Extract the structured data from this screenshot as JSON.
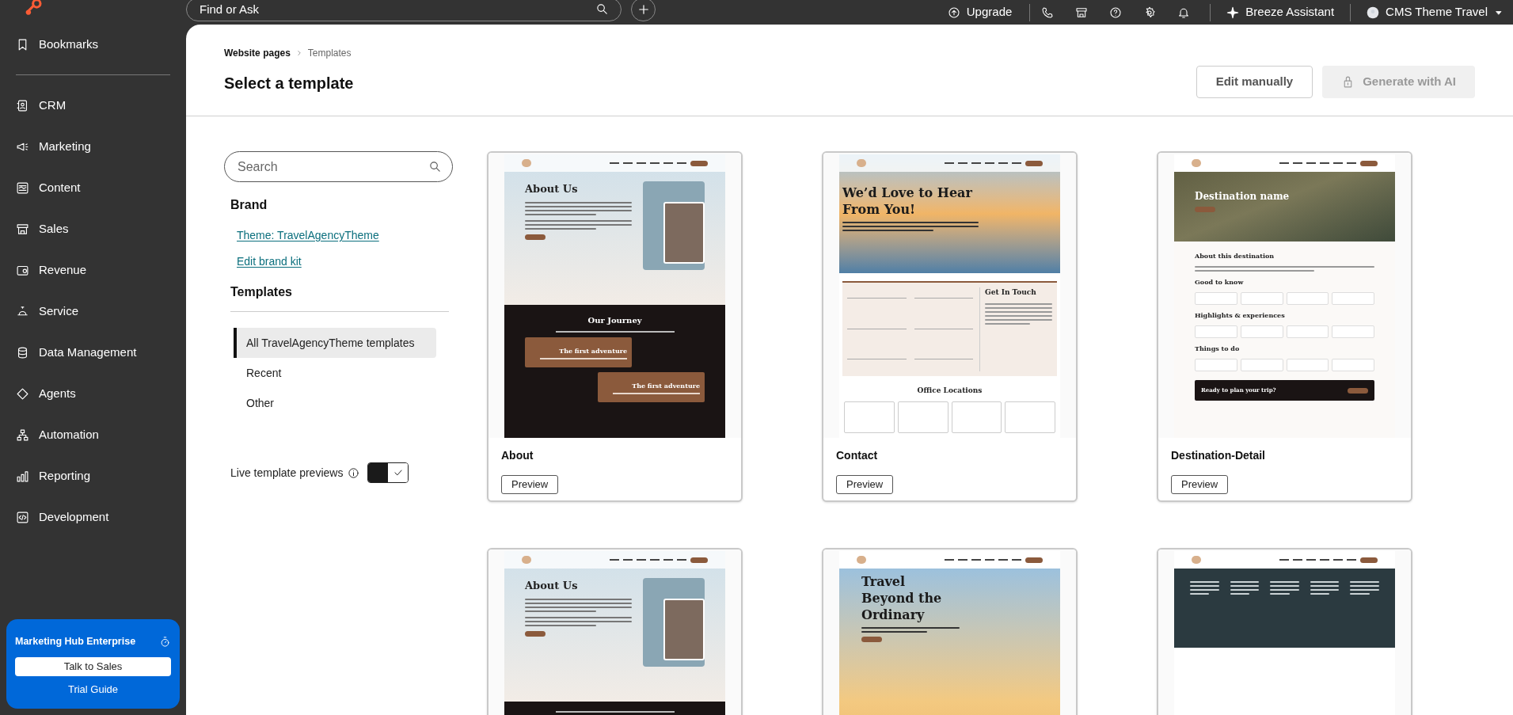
{
  "top_bar": {
    "search": {
      "placeholder": "Find or Ask"
    },
    "upgrade": "Upgrade",
    "assistant": "Breeze Assistant",
    "account": "CMS Theme Travel"
  },
  "sidebar": {
    "items": [
      {
        "label": "Bookmarks"
      },
      {
        "label": "CRM"
      },
      {
        "label": "Marketing"
      },
      {
        "label": "Content"
      },
      {
        "label": "Sales"
      },
      {
        "label": "Revenue"
      },
      {
        "label": "Service"
      },
      {
        "label": "Data Management"
      },
      {
        "label": "Agents"
      },
      {
        "label": "Automation"
      },
      {
        "label": "Reporting"
      },
      {
        "label": "Development"
      }
    ],
    "trial_card": {
      "title": "Marketing Hub Enterprise",
      "button": "Talk to Sales",
      "link": "Trial Guide"
    }
  },
  "header": {
    "breadcrumb": [
      "Website pages",
      "Templates"
    ],
    "title": "Select a template",
    "buttons": [
      {
        "label": "Edit manually",
        "disabled": false
      },
      {
        "label": "Generate with AI",
        "disabled": true
      }
    ]
  },
  "filters": {
    "search": {
      "placeholder": "Search"
    },
    "brand_heading": "Brand",
    "brand_links": [
      "Theme: TravelAgencyTheme",
      "Edit brand kit"
    ],
    "templates_heading": "Templates",
    "categories": [
      {
        "label": "All TravelAgencyTheme templates",
        "selected": true
      },
      {
        "label": "Recent",
        "selected": false
      },
      {
        "label": "Other",
        "selected": false
      }
    ],
    "live_previews": {
      "label": "Live template previews",
      "on": true
    }
  },
  "templates": [
    {
      "name": "About",
      "preview_button": "Preview",
      "thumbnail": {
        "kind": "about",
        "headings": [
          "About Us",
          "Our Journey",
          "The first adventure",
          "The first adventure"
        ]
      }
    },
    {
      "name": "Contact",
      "preview_button": "Preview",
      "thumbnail": {
        "kind": "contact",
        "headings": [
          "We’d Love to Hear From You!",
          "Get In Touch",
          "Office Locations"
        ]
      }
    },
    {
      "name": "Destination-Detail",
      "preview_button": "Preview",
      "thumbnail": {
        "kind": "destination",
        "headings": [
          "Destination name",
          "About this destination",
          "Good to know",
          "Highlights & experiences",
          "Things to do",
          "Ready to plan your trip?"
        ]
      }
    },
    {
      "thumbnail": {
        "kind": "about",
        "headings": [
          "About Us"
        ]
      }
    },
    {
      "thumbnail": {
        "kind": "hero",
        "headings": [
          "Travel Beyond the Ordinary"
        ]
      }
    },
    {
      "thumbnail": {
        "kind": "footer"
      }
    }
  ]
}
